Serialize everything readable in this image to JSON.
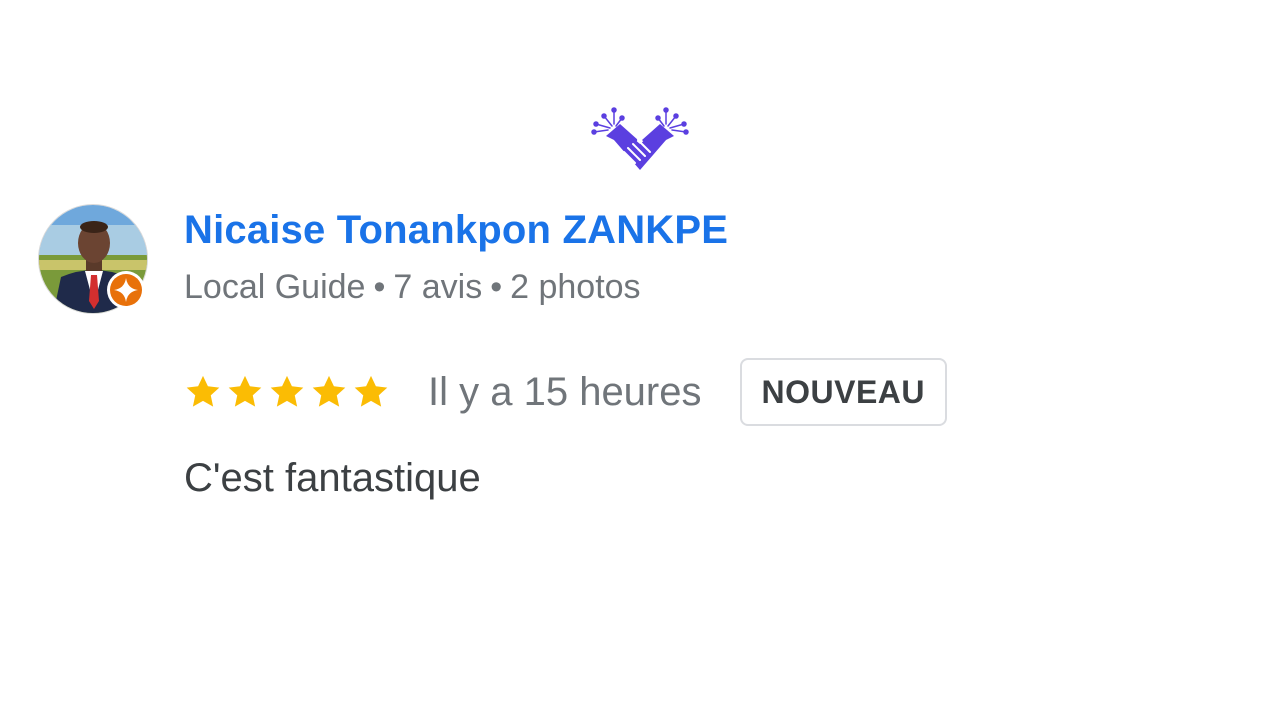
{
  "logo": {
    "icon": "handshake-heart-icon",
    "color": "#5b3fe0"
  },
  "reviewer": {
    "name": "Nicaise Tonankpon ZANKPE",
    "guide_label": "Local Guide",
    "reviews_count": "7 avis",
    "photos_count": "2 photos",
    "separator": "•",
    "avatar_icon": "profile-photo",
    "badge_icon": "local-guide-star-icon",
    "badge_color": "#e8710a"
  },
  "review": {
    "rating": 5,
    "rating_max": 5,
    "star_color": "#fbbc04",
    "time_ago": "Il y a 15 heures",
    "badge_label": "NOUVEAU",
    "text": "C'est fantastique"
  },
  "colors": {
    "name": "#1a73e8",
    "meta": "#70757a",
    "text": "#3c4043"
  }
}
